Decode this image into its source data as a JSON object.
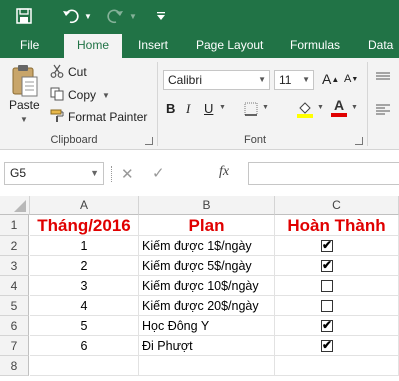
{
  "ribbon_tabs": [
    "File",
    "Home",
    "Insert",
    "Page Layout",
    "Formulas",
    "Data"
  ],
  "active_tab": "Home",
  "clipboard": {
    "paste_label": "Paste",
    "cut_label": "Cut",
    "copy_label": "Copy",
    "format_painter_label": "Format Painter",
    "group_label": "Clipboard"
  },
  "font": {
    "family": "Calibri",
    "size": "11",
    "group_label": "Font"
  },
  "formula_bar": {
    "name_box": "G5",
    "fx_label": "fx",
    "formula_value": ""
  },
  "columns": [
    "A",
    "B",
    "C"
  ],
  "rows": [
    "1",
    "2",
    "3",
    "4",
    "5",
    "6",
    "7",
    "8"
  ],
  "sheet": {
    "headers": {
      "month": "Tháng/2016",
      "plan": "Plan",
      "done": "Hoàn Thành"
    },
    "records": [
      {
        "month": "1",
        "plan": "Kiếm được 1$/ngày",
        "done": true
      },
      {
        "month": "2",
        "plan": "Kiếm được 5$/ngày",
        "done": true
      },
      {
        "month": "3",
        "plan": "Kiếm được 10$/ngày",
        "done": false
      },
      {
        "month": "4",
        "plan": "Kiếm được 20$/ngày",
        "done": false
      },
      {
        "month": "5",
        "plan": "Học Đông Y",
        "done": true
      },
      {
        "month": "6",
        "plan": "Đi Phượt",
        "done": true
      }
    ]
  },
  "colors": {
    "brand_green": "#217346",
    "header_red": "#e00000",
    "ribbon_bg": "#f3f3f3"
  },
  "icons": {
    "save": "save-icon",
    "undo": "undo-icon",
    "redo": "redo-icon",
    "customize": "customize-quick-access-icon"
  }
}
